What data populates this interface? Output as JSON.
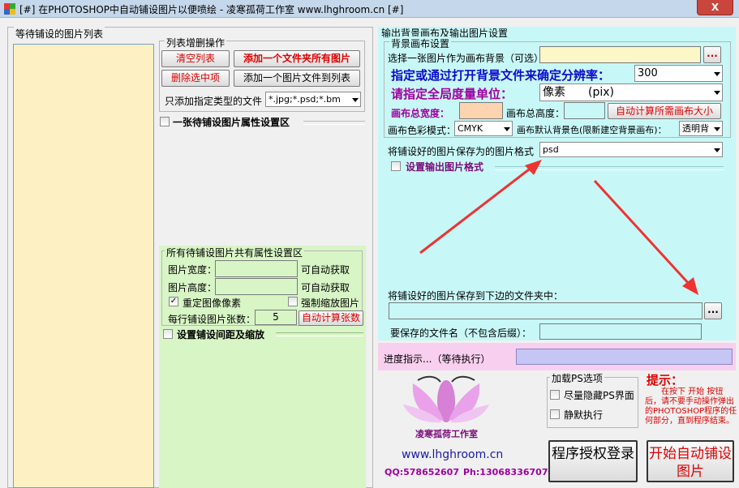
{
  "window": {
    "title": "[#] 在PHOTOSHOP中自动铺设图片以便喷绘 - 凌寒孤荷工作室 www.lhghroom.cn [#]",
    "close_label": "X"
  },
  "left": {
    "list_title": "等待铺设的图片列表",
    "ops_title": "列表增删操作",
    "clear_btn": "清空列表",
    "add_folder_btn": "添加一个文件夹所有图片",
    "delete_btn": "删除选中项",
    "add_file_btn": "添加一个图片文件到列表",
    "filter_label": "只添加指定类型的文件",
    "filter_value": "*.jpg;*.psd;*.bm",
    "single_props_label": "一张待铺设图片属性设置区",
    "common_title": "所有待铺设图片共有属性设置区",
    "width_label": "图片宽度：",
    "height_label": "图片高度：",
    "auto_get_1": "可自动获取",
    "auto_get_2": "可自动获取",
    "resample_label": "重定图像像素",
    "force_scale_label": "强制缩放图片",
    "per_row_label": "每行铺设图片张数：",
    "per_row_value": "5",
    "auto_count_btn": "自动计算张数",
    "spacing_label": "设置铺设间距及缩放"
  },
  "right": {
    "output_title": "输出背景画布及输出图片设置",
    "bg_title": "背景画布设置",
    "pick_bg_label": "选择一张图片作为画布背景（可选）",
    "browse_1": "...",
    "resolution_label": "指定或通过打开背景文件来确定分辨率：",
    "resolution_value": "300",
    "unit_label": "请指定全局度量单位：",
    "unit_value": "像素　　(pix)",
    "total_width_label": "画布总宽度：",
    "total_height_label": "画布总高度：",
    "auto_size_btn": "自动计算所需画布大小",
    "color_mode_label": "画布色彩模式：",
    "color_mode_value": "CMYK",
    "bg_color_label": "画布默认背景色(限新建空背景画布)：",
    "bg_color_value": "透明背",
    "save_format_label": "将铺设好的图片保存为的图片格式",
    "save_format_value": "psd",
    "output_format_label": "设置输出图片格式",
    "save_folder_label": "将铺设好的图片保存到下边的文件夹中：",
    "browse_2": "...",
    "filename_label": "要保存的文件名（不包含后缀）：",
    "progress_label": "进度指示...（等待执行）",
    "ps_options_title": "加载PS选项",
    "hide_ps_label": "尽量隐藏PS界面",
    "silent_label": "静默执行",
    "hint_title": "提示：",
    "hint_text": "在按下 开始 按钮后，请不要手动操作弹出的PHOTOSHOP程序的任何部分，直到程序结束。",
    "license_btn": "程序授权登录",
    "start_btn": "开始自动铺设图片"
  },
  "brand": {
    "logo_caption": "凌寒孤荷工作室",
    "url": "www.lhghroom.cn",
    "qq": "QQ:578652607",
    "phone": "Ph:13068336707"
  },
  "colors": {
    "list_bg": "#fdf1c4",
    "common_bg": "#d8f5c6",
    "output_bg": "#c8f7f7",
    "progress_bg": "#f8cfee",
    "progress_bar": "#c6c6f4",
    "arrow": "#ee3333"
  }
}
